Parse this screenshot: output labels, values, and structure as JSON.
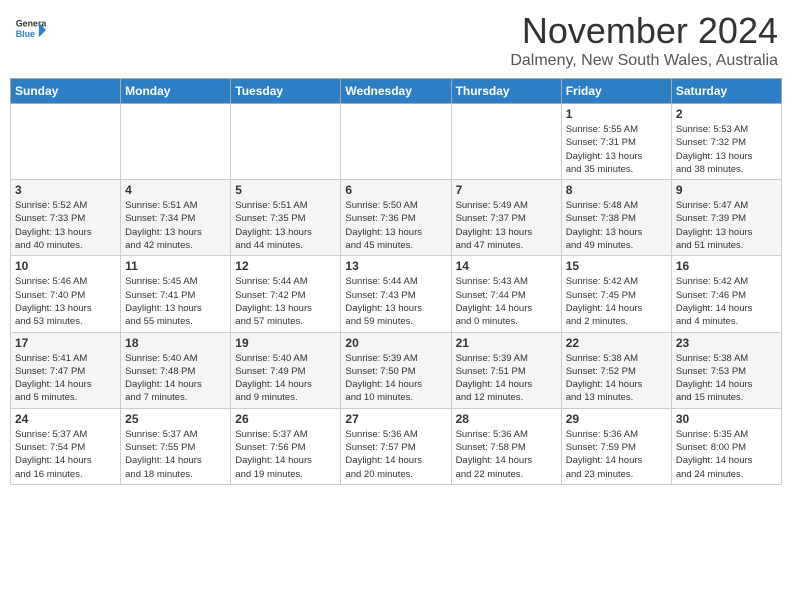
{
  "header": {
    "logo_line1": "General",
    "logo_line2": "Blue",
    "month": "November 2024",
    "location": "Dalmeny, New South Wales, Australia"
  },
  "weekdays": [
    "Sunday",
    "Monday",
    "Tuesday",
    "Wednesday",
    "Thursday",
    "Friday",
    "Saturday"
  ],
  "weeks": [
    [
      {
        "day": "",
        "info": ""
      },
      {
        "day": "",
        "info": ""
      },
      {
        "day": "",
        "info": ""
      },
      {
        "day": "",
        "info": ""
      },
      {
        "day": "",
        "info": ""
      },
      {
        "day": "1",
        "info": "Sunrise: 5:55 AM\nSunset: 7:31 PM\nDaylight: 13 hours\nand 35 minutes."
      },
      {
        "day": "2",
        "info": "Sunrise: 5:53 AM\nSunset: 7:32 PM\nDaylight: 13 hours\nand 38 minutes."
      }
    ],
    [
      {
        "day": "3",
        "info": "Sunrise: 5:52 AM\nSunset: 7:33 PM\nDaylight: 13 hours\nand 40 minutes."
      },
      {
        "day": "4",
        "info": "Sunrise: 5:51 AM\nSunset: 7:34 PM\nDaylight: 13 hours\nand 42 minutes."
      },
      {
        "day": "5",
        "info": "Sunrise: 5:51 AM\nSunset: 7:35 PM\nDaylight: 13 hours\nand 44 minutes."
      },
      {
        "day": "6",
        "info": "Sunrise: 5:50 AM\nSunset: 7:36 PM\nDaylight: 13 hours\nand 45 minutes."
      },
      {
        "day": "7",
        "info": "Sunrise: 5:49 AM\nSunset: 7:37 PM\nDaylight: 13 hours\nand 47 minutes."
      },
      {
        "day": "8",
        "info": "Sunrise: 5:48 AM\nSunset: 7:38 PM\nDaylight: 13 hours\nand 49 minutes."
      },
      {
        "day": "9",
        "info": "Sunrise: 5:47 AM\nSunset: 7:39 PM\nDaylight: 13 hours\nand 51 minutes."
      }
    ],
    [
      {
        "day": "10",
        "info": "Sunrise: 5:46 AM\nSunset: 7:40 PM\nDaylight: 13 hours\nand 53 minutes."
      },
      {
        "day": "11",
        "info": "Sunrise: 5:45 AM\nSunset: 7:41 PM\nDaylight: 13 hours\nand 55 minutes."
      },
      {
        "day": "12",
        "info": "Sunrise: 5:44 AM\nSunset: 7:42 PM\nDaylight: 13 hours\nand 57 minutes."
      },
      {
        "day": "13",
        "info": "Sunrise: 5:44 AM\nSunset: 7:43 PM\nDaylight: 13 hours\nand 59 minutes."
      },
      {
        "day": "14",
        "info": "Sunrise: 5:43 AM\nSunset: 7:44 PM\nDaylight: 14 hours\nand 0 minutes."
      },
      {
        "day": "15",
        "info": "Sunrise: 5:42 AM\nSunset: 7:45 PM\nDaylight: 14 hours\nand 2 minutes."
      },
      {
        "day": "16",
        "info": "Sunrise: 5:42 AM\nSunset: 7:46 PM\nDaylight: 14 hours\nand 4 minutes."
      }
    ],
    [
      {
        "day": "17",
        "info": "Sunrise: 5:41 AM\nSunset: 7:47 PM\nDaylight: 14 hours\nand 5 minutes."
      },
      {
        "day": "18",
        "info": "Sunrise: 5:40 AM\nSunset: 7:48 PM\nDaylight: 14 hours\nand 7 minutes."
      },
      {
        "day": "19",
        "info": "Sunrise: 5:40 AM\nSunset: 7:49 PM\nDaylight: 14 hours\nand 9 minutes."
      },
      {
        "day": "20",
        "info": "Sunrise: 5:39 AM\nSunset: 7:50 PM\nDaylight: 14 hours\nand 10 minutes."
      },
      {
        "day": "21",
        "info": "Sunrise: 5:39 AM\nSunset: 7:51 PM\nDaylight: 14 hours\nand 12 minutes."
      },
      {
        "day": "22",
        "info": "Sunrise: 5:38 AM\nSunset: 7:52 PM\nDaylight: 14 hours\nand 13 minutes."
      },
      {
        "day": "23",
        "info": "Sunrise: 5:38 AM\nSunset: 7:53 PM\nDaylight: 14 hours\nand 15 minutes."
      }
    ],
    [
      {
        "day": "24",
        "info": "Sunrise: 5:37 AM\nSunset: 7:54 PM\nDaylight: 14 hours\nand 16 minutes."
      },
      {
        "day": "25",
        "info": "Sunrise: 5:37 AM\nSunset: 7:55 PM\nDaylight: 14 hours\nand 18 minutes."
      },
      {
        "day": "26",
        "info": "Sunrise: 5:37 AM\nSunset: 7:56 PM\nDaylight: 14 hours\nand 19 minutes."
      },
      {
        "day": "27",
        "info": "Sunrise: 5:36 AM\nSunset: 7:57 PM\nDaylight: 14 hours\nand 20 minutes."
      },
      {
        "day": "28",
        "info": "Sunrise: 5:36 AM\nSunset: 7:58 PM\nDaylight: 14 hours\nand 22 minutes."
      },
      {
        "day": "29",
        "info": "Sunrise: 5:36 AM\nSunset: 7:59 PM\nDaylight: 14 hours\nand 23 minutes."
      },
      {
        "day": "30",
        "info": "Sunrise: 5:35 AM\nSunset: 8:00 PM\nDaylight: 14 hours\nand 24 minutes."
      }
    ]
  ]
}
